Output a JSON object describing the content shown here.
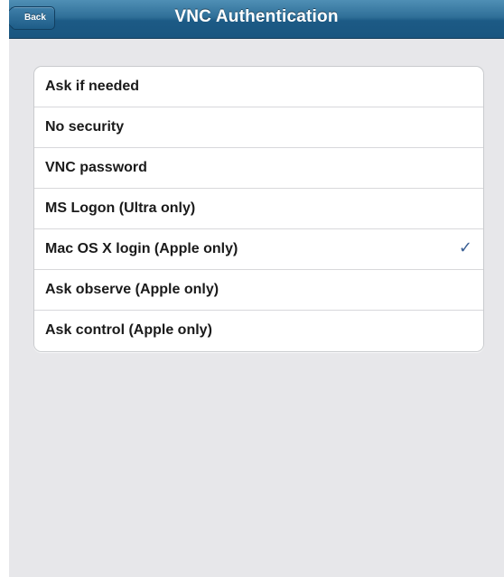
{
  "navbar": {
    "title": "VNC Authentication",
    "back_label": "Back"
  },
  "options": [
    {
      "label": "Ask if needed",
      "selected": false
    },
    {
      "label": "No security",
      "selected": false
    },
    {
      "label": "VNC password",
      "selected": false
    },
    {
      "label": "MS Logon (Ultra only)",
      "selected": false
    },
    {
      "label": "Mac OS X login (Apple only)",
      "selected": true
    },
    {
      "label": "Ask observe (Apple only)",
      "selected": false
    },
    {
      "label": "Ask control (Apple only)",
      "selected": false
    }
  ],
  "selected_mark": "✓",
  "colors": {
    "navbar": "#1c5a85",
    "background": "#e7e7ea",
    "checkmark": "#3a5f94"
  }
}
